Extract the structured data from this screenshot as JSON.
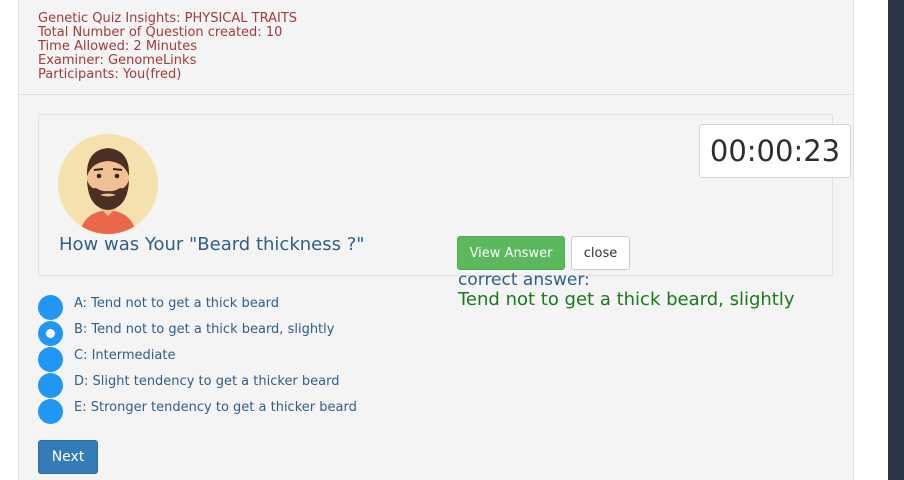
{
  "quiz_info": {
    "title_line": "Genetic Quiz Insights: PHYSICAL TRAITS",
    "questions_line": "Total Number of Question created: 10",
    "time_line": "Time Allowed: 2 Minutes",
    "examiner_line": "Examiner: GenomeLinks",
    "participants_line": "Participants: You(fred)"
  },
  "timer": "00:00:23",
  "question": "How was Your \"Beard thickness ?\"",
  "buttons": {
    "view_answer": "View Answer",
    "close": "close",
    "next": "Next"
  },
  "answer": {
    "label": "correct answer:",
    "value": "Tend not to get a thick beard, slightly"
  },
  "options": [
    {
      "label": "A: Tend not to get a thick beard",
      "selected": false
    },
    {
      "label": "B: Tend not to get a thick beard, slightly",
      "selected": true
    },
    {
      "label": "C: Intermediate",
      "selected": false
    },
    {
      "label": "D: Slight tendency to get a thicker beard",
      "selected": false
    },
    {
      "label": "E: Stronger tendency to get a thicker beard",
      "selected": false
    }
  ],
  "colors": {
    "info_text": "#a23b3b",
    "question_text": "#2f5f8a",
    "radio": "#2196f3",
    "view_button": "#5cb85c",
    "next_button": "#337ab7",
    "correct_value": "#1a7a1a"
  },
  "avatar_icon": "bearded-man-avatar-icon"
}
